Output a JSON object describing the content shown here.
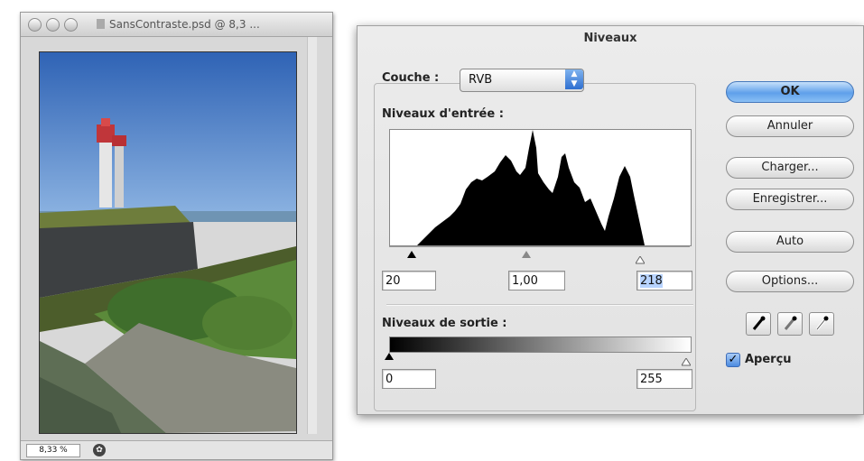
{
  "document_window": {
    "title": "SansContraste.psd @ 8,3 ...",
    "zoom": "8,33 %"
  },
  "dialog": {
    "title": "Niveaux",
    "channel_label": "Couche :",
    "channel_value": "RVB",
    "input_levels_label": "Niveaux d'entrée :",
    "input_black": "20",
    "input_gamma": "1,00",
    "input_white": "218",
    "output_levels_label": "Niveaux de sortie :",
    "output_black": "0",
    "output_white": "255",
    "buttons": {
      "ok": "OK",
      "cancel": "Annuler",
      "load": "Charger...",
      "save": "Enregistrer...",
      "auto": "Auto",
      "options": "Options..."
    },
    "preview_label": "Aperçu",
    "preview_checked": true
  },
  "colors": {
    "accent": "#5fa0ea",
    "selection": "#b7d3ff"
  },
  "icons": [
    "eyedropper-black-icon",
    "eyedropper-gray-icon",
    "eyedropper-white-icon",
    "checkbox-check-icon",
    "select-arrows-icon"
  ]
}
